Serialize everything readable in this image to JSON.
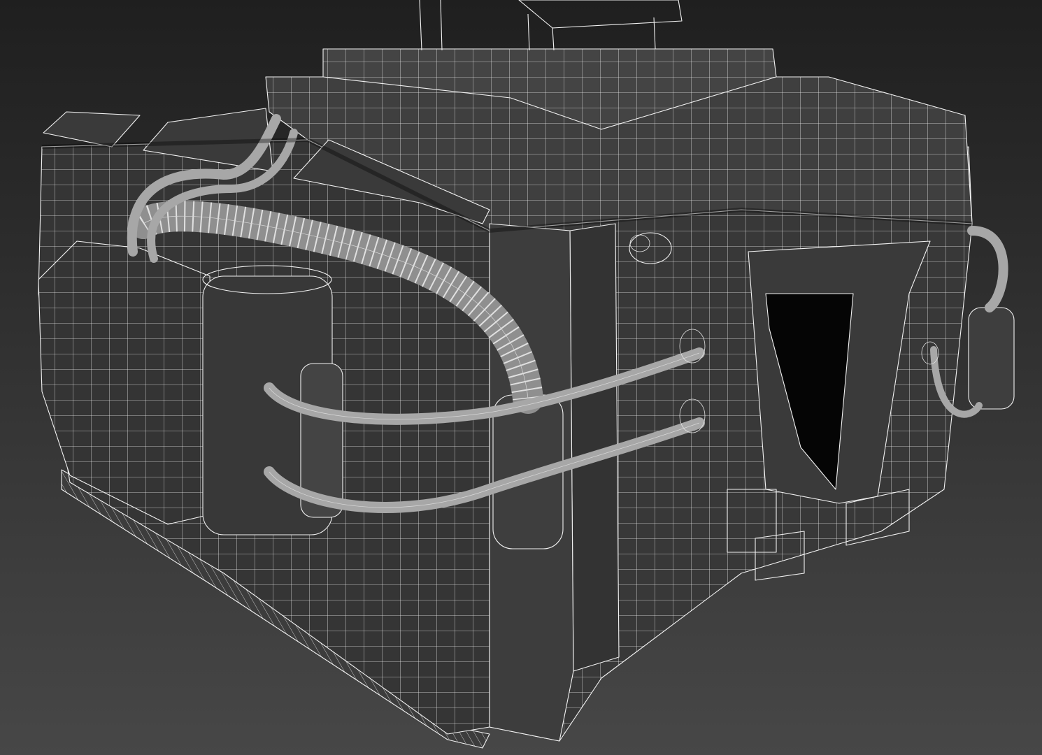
{
  "viewport": {
    "background_top": "#1f1f1f",
    "background_bottom": "#474747",
    "wire_color": "#f2f2f2",
    "surface_color": "#3a3a3a",
    "pipe_color": "#9a9a9a",
    "opening_color": "#050505"
  },
  "model": {
    "display_mode": "shaded-wireframe",
    "subject": "sci-fi-bunker"
  }
}
